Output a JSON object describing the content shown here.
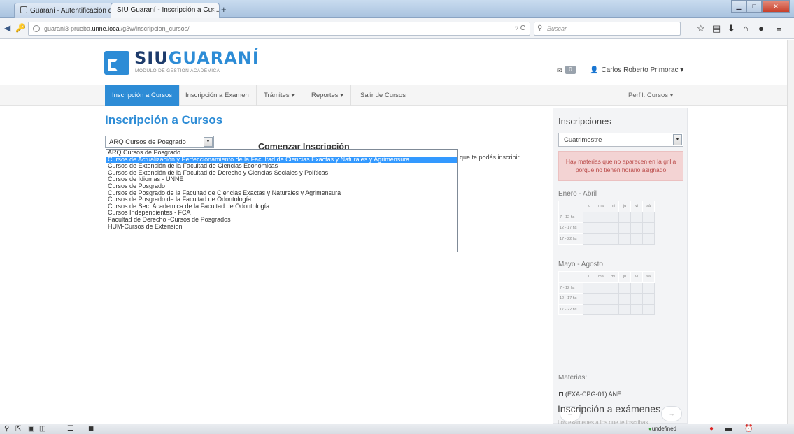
{
  "browser": {
    "tabs": [
      {
        "label": "Guarani - Autentificación d..."
      },
      {
        "label": "SIU Guaraní - Inscripción a Cur..."
      }
    ],
    "new_tab": "+",
    "url_prefix": "guarani3-prueba.",
    "url_domain": "unne.local",
    "url_path": "/g3w/inscripcion_cursos/",
    "search_placeholder": "Buscar"
  },
  "app": {
    "logo_siu": "SIU",
    "logo_guarani": "GUARANÍ",
    "logo_subtitle": "MÓDULO DE GESTIÓN ACADÉMICA",
    "message_count": "0",
    "user_name": "Carlos Roberto Primorac",
    "menu": [
      {
        "label": "Inscripción a Cursos",
        "active": true
      },
      {
        "label": "Inscripción a Examen"
      },
      {
        "label": "Trámites ▾"
      },
      {
        "label": "Reportes ▾"
      },
      {
        "label": "Salir de Cursos"
      }
    ],
    "perfil": "Perfil: Cursos ▾"
  },
  "main": {
    "title": "Inscripción a Cursos",
    "select_value": "ARQ Cursos de Posgrado",
    "comenzar": "Comenzar Inscripción",
    "info_text": "que te podés inscribir.",
    "options": [
      "ARQ Cursos de Posgrado",
      "Cursos de Actualización y Perfeccionamiento de la Facultad de Ciencias Exactas y Naturales y Agrimensura",
      "Cursos de Extensión de la Facultad de Ciencias Económicas",
      "Cursos de Extensión de la Facultad de Derecho y Ciencias Sociales y Políticas",
      "Cursos de Idiomas - UNNE",
      "Cursos de Posgrado",
      "Cursos de Posgrado de la Facultad de Ciencias Exactas y Naturales y Agrimensura",
      "Cursos de Posgrado de la Facultad de Odontología",
      "Cursos de Sec. Academica de la Facultad de Odontología",
      "Cursos Independientes - FCA",
      "Facultad de Derecho -Cursos de Posgrados",
      "HUM-Cursos de Extension"
    ],
    "selected_option_index": 1
  },
  "sidebar": {
    "title": "Inscripciones",
    "period_select": "Cuatrimestre",
    "alert": "Hay materias que no aparecen en la grilla porque no tienen horario asignado",
    "grid1_title": "Enero - Abril",
    "grid2_title": "Mayo - Agosto",
    "days": [
      "lu",
      "ma",
      "mi",
      "ju",
      "vi",
      "sá"
    ],
    "rows": [
      "7 - 12 hs",
      "12 - 17 hs",
      "17 - 22 hs"
    ],
    "materias_label": "Materias:",
    "materia_item": "(EXA-CPG-01) ANE",
    "prev": "←",
    "next": "→",
    "footer_title": "Inscripción a exámenes",
    "footer_text": "Los exámenes a los que te inscribas"
  },
  "statusbar": {
    "undefined_label": "undefined"
  }
}
